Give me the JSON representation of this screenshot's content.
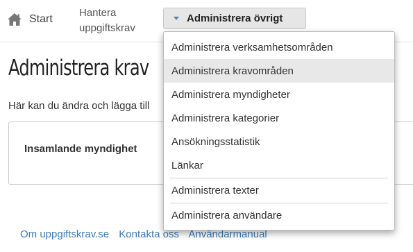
{
  "nav": {
    "home_label": "Start",
    "hantera_label": "Hantera uppgiftskrav",
    "dropdown_label": "Administrera övrigt"
  },
  "page": {
    "title": "Administrera krav",
    "intro": "Här kan du ändra och lägga till",
    "panel_label": "Insamlande myndighet"
  },
  "dropdown": {
    "items": [
      {
        "label": "Administrera verksamhetsområden"
      },
      {
        "label": "Administrera kravområden"
      },
      {
        "label": "Administrera myndigheter"
      },
      {
        "label": "Administrera kategorier"
      },
      {
        "label": "Ansökningsstatistik"
      },
      {
        "label": "Länkar"
      },
      {
        "label": "Administrera texter"
      },
      {
        "label": "Administrera användare"
      }
    ]
  },
  "footer": {
    "links": [
      {
        "label": "Om uppgiftskrav.se"
      },
      {
        "label": "Kontakta oss"
      },
      {
        "label": "Användarmanual"
      }
    ]
  }
}
